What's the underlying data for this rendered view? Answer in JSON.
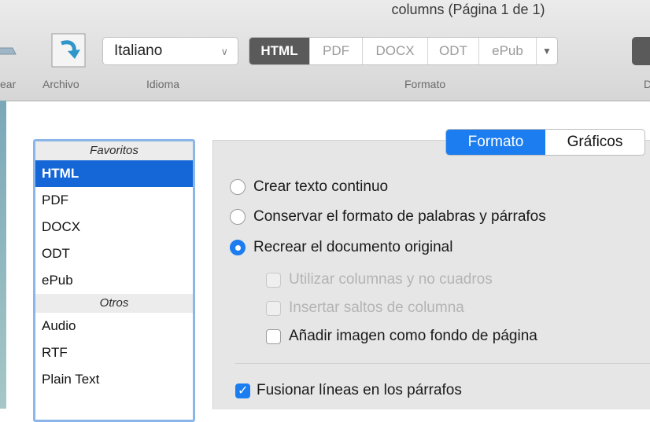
{
  "window": {
    "title": "columns (Página 1 de 1)"
  },
  "toolbar": {
    "labels": {
      "crear": "ear",
      "archivo": "Archivo",
      "idioma": "Idioma",
      "formato": "Formato",
      "right_cut": "D"
    },
    "language": {
      "value": "Italiano"
    },
    "formats": [
      "HTML",
      "PDF",
      "DOCX",
      "ODT",
      "ePub"
    ],
    "selected_format": "HTML"
  },
  "sidebar": {
    "favorites_header": "Favoritos",
    "favorites": [
      "HTML",
      "PDF",
      "DOCX",
      "ODT",
      "ePub"
    ],
    "others_header": "Otros",
    "others": [
      "Audio",
      "RTF",
      "Plain Text"
    ],
    "selected": "HTML"
  },
  "tabs": {
    "formato": "Formato",
    "graficos": "Gráficos",
    "active": "Formato"
  },
  "options": {
    "radios": [
      {
        "label": "Crear texto continuo",
        "checked": false
      },
      {
        "label": "Conservar el formato de palabras y párrafos",
        "checked": false
      },
      {
        "label": "Recrear el documento original",
        "checked": true
      }
    ],
    "sub_checks": [
      {
        "label": "Utilizar columnas y no cuadros",
        "checked": false,
        "disabled": true
      },
      {
        "label": "Insertar saltos de columna",
        "checked": false,
        "disabled": true
      },
      {
        "label": "Añadir imagen como fondo de página",
        "checked": false,
        "disabled": false
      }
    ],
    "merge_lines": {
      "label": "Fusionar líneas en los párrafos",
      "checked": true
    }
  },
  "colors": {
    "accent": "#1b7df0",
    "selection": "#1566d6",
    "segment_active": "#5a5a5a"
  }
}
